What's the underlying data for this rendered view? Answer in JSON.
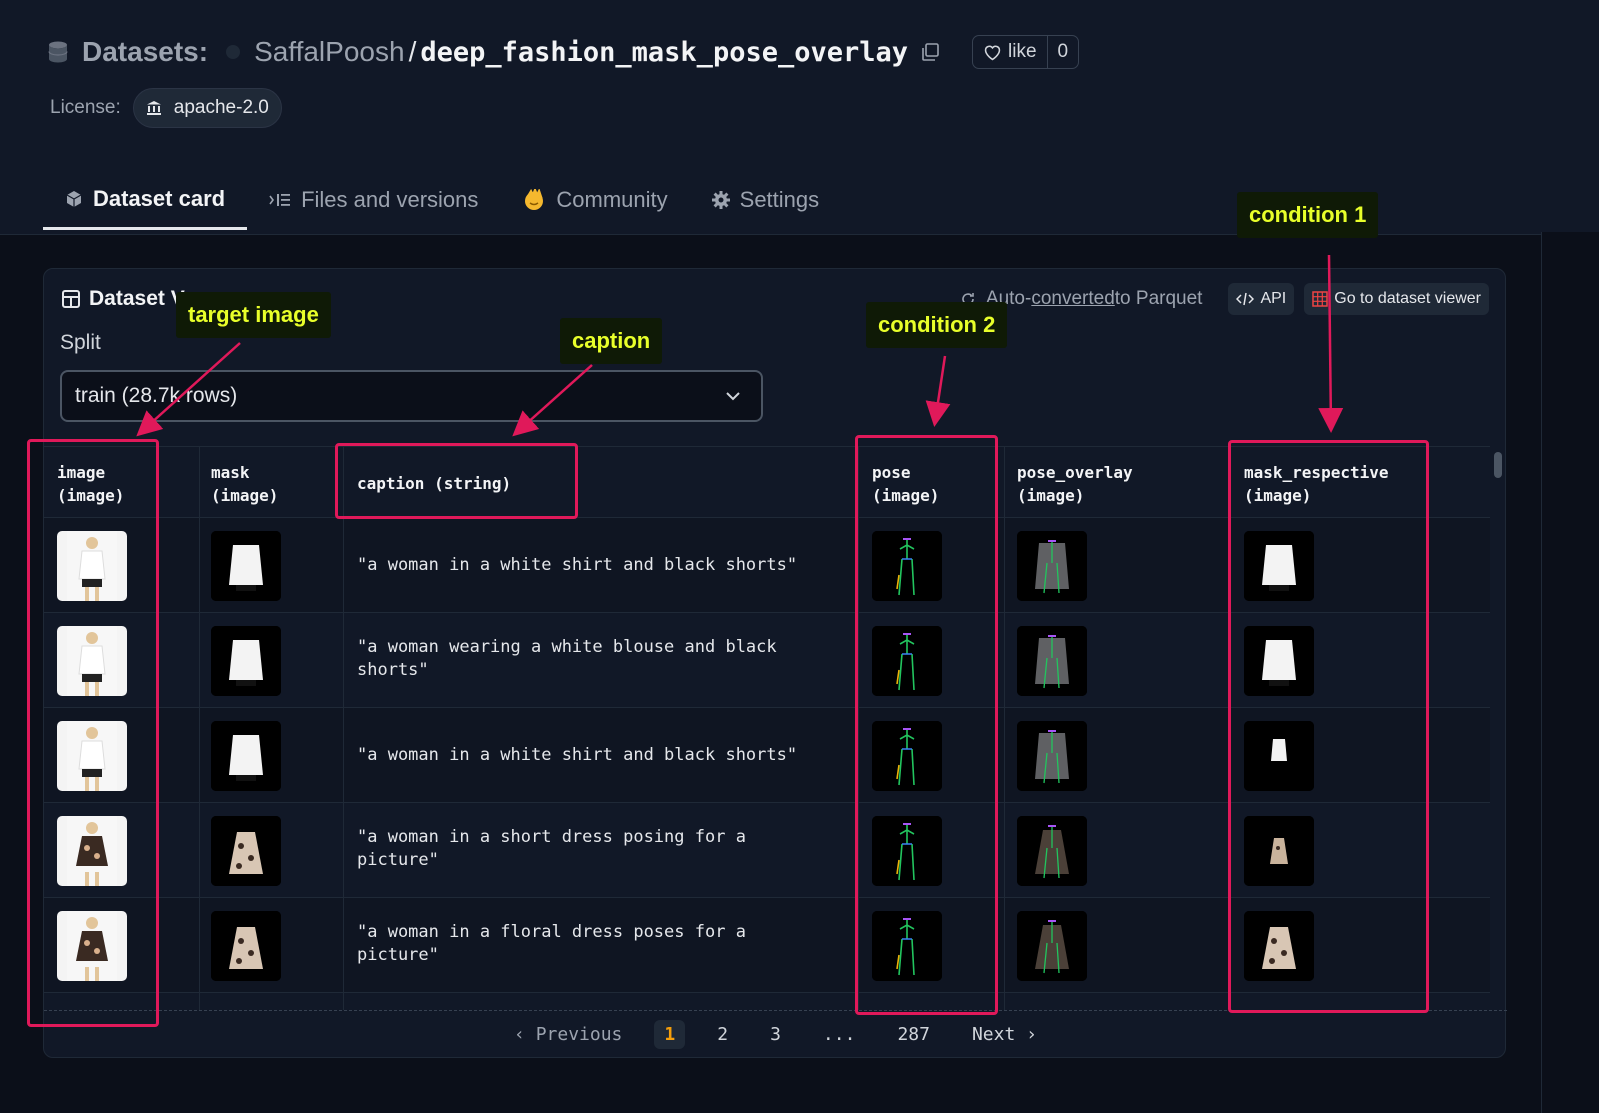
{
  "header": {
    "section": "Datasets:",
    "owner": "SaffalPoosh",
    "slash": "/",
    "dataset_name": "deep_fashion_mask_pose_overlay",
    "like_label": "like",
    "like_count": "0",
    "license_label": "License:",
    "license_value": "apache-2.0"
  },
  "tabs": [
    {
      "label": "Dataset card",
      "icon": "cube-icon",
      "active": true
    },
    {
      "label": "Files and versions",
      "icon": "files-icon",
      "active": false
    },
    {
      "label": "Community",
      "icon": "community-emoji-icon",
      "active": false
    },
    {
      "label": "Settings",
      "icon": "gear-icon",
      "active": false
    }
  ],
  "viewer": {
    "title": "Dataset V",
    "auto_prefix": "Auto-",
    "auto_link": "converted",
    "auto_suffix": " to Parquet",
    "api_label": "API",
    "goto_label": "Go to dataset viewer",
    "split_label": "Split",
    "split_value": "train (28.7k rows)"
  },
  "table": {
    "columns": [
      {
        "name": "image",
        "type": "(image)"
      },
      {
        "name": "mask",
        "type": "(image)"
      },
      {
        "name": "caption (string)",
        "type": ""
      },
      {
        "name": "pose",
        "type": "(image)"
      },
      {
        "name": "pose_overlay",
        "type": "(image)"
      },
      {
        "name": "mask_respective",
        "type": "(image)"
      }
    ],
    "rows": [
      {
        "caption": "\"a woman in a white shirt and black shorts\""
      },
      {
        "caption": "\"a woman wearing a white blouse and black shorts\""
      },
      {
        "caption": "\"a woman in a white shirt and black shorts\""
      },
      {
        "caption": "\"a woman in a short dress posing for a picture\""
      },
      {
        "caption": "\"a woman in a floral dress poses for a picture\""
      }
    ]
  },
  "pager": {
    "prev": "Previous",
    "pages": [
      "1",
      "2",
      "3",
      "...",
      "287"
    ],
    "next": "Next",
    "current": "1"
  },
  "annotations": {
    "target_image": "target image",
    "caption": "caption",
    "condition_2": "condition 2",
    "condition_1": "condition 1",
    "color": "#e0195a",
    "label_color": "#e8ff2a"
  }
}
